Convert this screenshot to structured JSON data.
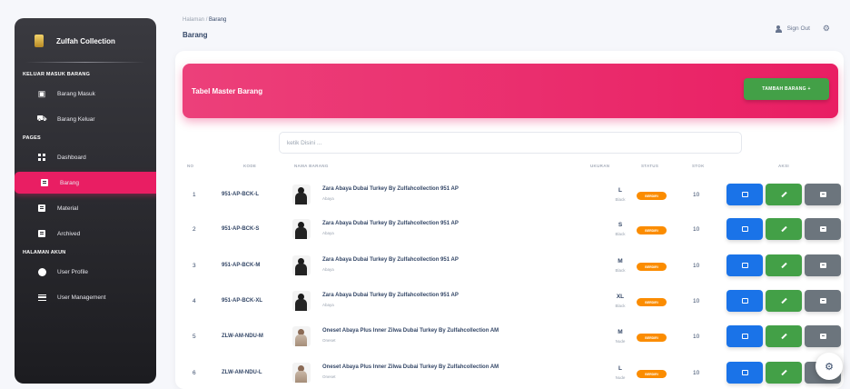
{
  "sidebar": {
    "brand": "Zulfah Collection",
    "sections": [
      {
        "title": "KELUAR MASUK BARANG",
        "items": [
          {
            "label": "Barang Masuk",
            "icon": "box-icon"
          },
          {
            "label": "Barang Keluar",
            "icon": "truck-icon"
          }
        ]
      },
      {
        "title": "PAGES",
        "items": [
          {
            "label": "Dashboard",
            "icon": "dashboard-icon"
          },
          {
            "label": "Barang",
            "icon": "list-icon",
            "active": true
          },
          {
            "label": "Material",
            "icon": "material-icon"
          },
          {
            "label": "Archived",
            "icon": "archive-icon"
          }
        ]
      },
      {
        "title": "HALAMAN AKUN",
        "items": [
          {
            "label": "User Profile",
            "icon": "user-circle-icon"
          },
          {
            "label": "User Management",
            "icon": "users-list-icon"
          }
        ]
      }
    ]
  },
  "header": {
    "breadcrumb_parent": "Halaman",
    "breadcrumb_sep": "/",
    "breadcrumb_current": "Barang",
    "page_title": "Barang",
    "sign_out": "Sign Out"
  },
  "card": {
    "title": "Tabel Master Barang",
    "add_button": "TAMBAH BARANG +"
  },
  "search": {
    "placeholder": "ketik Disini ..."
  },
  "table": {
    "headers": [
      "NO",
      "KODE",
      "NAMA BARANG",
      "UKURAN",
      "STATUS",
      "STOK",
      "AKSI"
    ],
    "rows": [
      {
        "no": "1",
        "kode": "951-AP-BCK-L",
        "nama": "Zara Abaya Dubai Turkey By Zulfahcollection 951 AP",
        "kategori": "Abaya",
        "ukuran": "L",
        "warna": "Black",
        "status": "BERDIRI",
        "stok": "10"
      },
      {
        "no": "2",
        "kode": "951-AP-BCK-S",
        "nama": "Zara Abaya Dubai Turkey By Zulfahcollection 951 AP",
        "kategori": "Abaya",
        "ukuran": "S",
        "warna": "Black",
        "status": "BERDIRI",
        "stok": "10"
      },
      {
        "no": "3",
        "kode": "951-AP-BCK-M",
        "nama": "Zara Abaya Dubai Turkey By Zulfahcollection 951 AP",
        "kategori": "Abaya",
        "ukuran": "M",
        "warna": "Black",
        "status": "BERDIRI",
        "stok": "10"
      },
      {
        "no": "4",
        "kode": "951-AP-BCK-XL",
        "nama": "Zara Abaya Dubai Turkey By Zulfahcollection 951 AP",
        "kategori": "Abaya",
        "ukuran": "XL",
        "warna": "Black",
        "status": "BERDIRI",
        "stok": "10"
      },
      {
        "no": "5",
        "kode": "ZLW-AM-NDU-M",
        "nama": "Oneset Abaya Plus Inner Zilwa Dubai Turkey By Zulfahcollection AM",
        "kategori": "Oneset",
        "ukuran": "M",
        "warna": "Nude",
        "status": "BERDIRI",
        "stok": "10"
      },
      {
        "no": "6",
        "kode": "ZLW-AM-NDU-L",
        "nama": "Oneset Abaya Plus Inner Zilwa Dubai Turkey By Zulfahcollection AM",
        "kategori": "Oneset",
        "ukuran": "L",
        "warna": "Nude",
        "status": "BERDIRI",
        "stok": "10"
      }
    ]
  },
  "colors": {
    "accent": "#e91e63",
    "success": "#43a047",
    "info": "#1a73e8",
    "warning": "#fb8c00",
    "secondary": "#6c757d"
  }
}
